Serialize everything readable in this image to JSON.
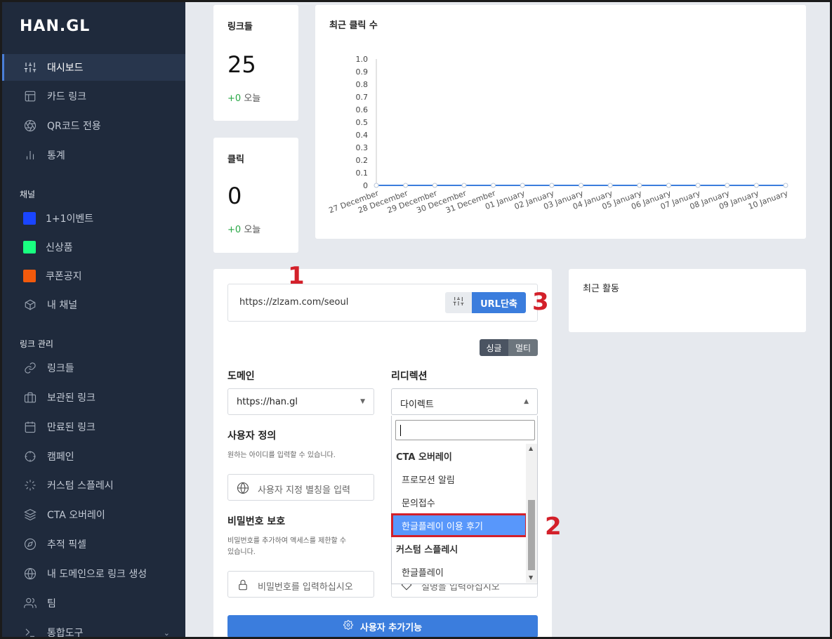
{
  "app": {
    "logo": "HAN.GL"
  },
  "sidebar": {
    "main_items": [
      {
        "label": "대시보드",
        "icon": "sliders-icon",
        "active": true
      },
      {
        "label": "카드 링크",
        "icon": "layout-icon"
      },
      {
        "label": "QR코드 전용",
        "icon": "aperture-icon"
      },
      {
        "label": "통계",
        "icon": "bar-chart-icon"
      }
    ],
    "channels_title": "채널",
    "channels": [
      {
        "label": "1+1이벤트",
        "color": "#1a45ff"
      },
      {
        "label": "신상품",
        "color": "#19ff80"
      },
      {
        "label": "쿠폰공지",
        "color": "#f25a0c"
      },
      {
        "label": "내 채널",
        "icon": "box-icon"
      }
    ],
    "links_title": "링크 관리",
    "link_items": [
      {
        "label": "링크들",
        "icon": "link-icon"
      },
      {
        "label": "보관된 링크",
        "icon": "briefcase-icon"
      },
      {
        "label": "만료된 링크",
        "icon": "calendar-icon"
      },
      {
        "label": "캠페인",
        "icon": "crosshair-icon"
      },
      {
        "label": "커스텀 스플레시",
        "icon": "loader-icon"
      },
      {
        "label": "CTA 오버레이",
        "icon": "layers-icon"
      },
      {
        "label": "추적 픽셀",
        "icon": "compass-icon"
      },
      {
        "label": "내 도메인으로 링크 생성",
        "icon": "globe-icon"
      },
      {
        "label": "팀",
        "icon": "users-icon"
      },
      {
        "label": "통합도구",
        "icon": "terminal-icon"
      }
    ]
  },
  "stats": {
    "links": {
      "title": "링크들",
      "value": "25",
      "delta": "+0",
      "delta_suffix": "오늘"
    },
    "clicks": {
      "title": "클릭",
      "value": "0",
      "delta": "+0",
      "delta_suffix": "오늘"
    }
  },
  "chart_data": {
    "type": "line",
    "title": "최근 클릭 수",
    "x": [
      "27 December",
      "28 December",
      "29 December",
      "30 December",
      "31 December",
      "01 January",
      "02 January",
      "03 January",
      "04 January",
      "05 January",
      "06 January",
      "07 January",
      "08 January",
      "09 January",
      "10 January"
    ],
    "series": [
      {
        "values": [
          0,
          0,
          0,
          0,
          0,
          0,
          0,
          0,
          0,
          0,
          0,
          0,
          0,
          0,
          0
        ]
      }
    ],
    "yticks": [
      "0",
      "0.1",
      "0.2",
      "0.3",
      "0.4",
      "0.5",
      "0.6",
      "0.7",
      "0.8",
      "0.9",
      "1.0"
    ],
    "ylim": [
      0,
      1.0
    ],
    "color": "#3b7ddd"
  },
  "shortener": {
    "url_value": "https://zlzam.com/seoul",
    "shorten_label": "URL단축",
    "mode_single": "싱글",
    "mode_multi": "멀티",
    "domain_label": "도메인",
    "domain_value": "https://han.gl",
    "redirect_label": "리디렉션",
    "redirect_value": "다이렉트",
    "custom_label": "사용자 정의",
    "custom_help": "원하는 아이디를 입력할 수 있습니다.",
    "custom_placeholder": "사용자 지정 별칭을 입력",
    "password_label": "비밀번호 보호",
    "password_help_1": "비밀번호를 추가하여 액세스를 제한할 수",
    "password_help_2": "있습니다.",
    "password_placeholder": "비밀번호를 입력하십시오",
    "hidden_placeholder": "설명을 입력하십시오",
    "advanced_button": "사용자 추가기능"
  },
  "dropdown": {
    "search_value": "",
    "group1": "CTA 오버레이",
    "group1_options": [
      "프로모션 알림",
      "문의접수",
      "한글플레이 이용 후기"
    ],
    "group2": "커스텀 스플레시",
    "group2_options": [
      "한글플레이"
    ],
    "highlighted": "한글플레이 이용 후기"
  },
  "recent_activity": {
    "title": "최근 활동"
  },
  "annotations": {
    "one": "1",
    "two": "2",
    "three": "3",
    "color": "#d3202a"
  }
}
